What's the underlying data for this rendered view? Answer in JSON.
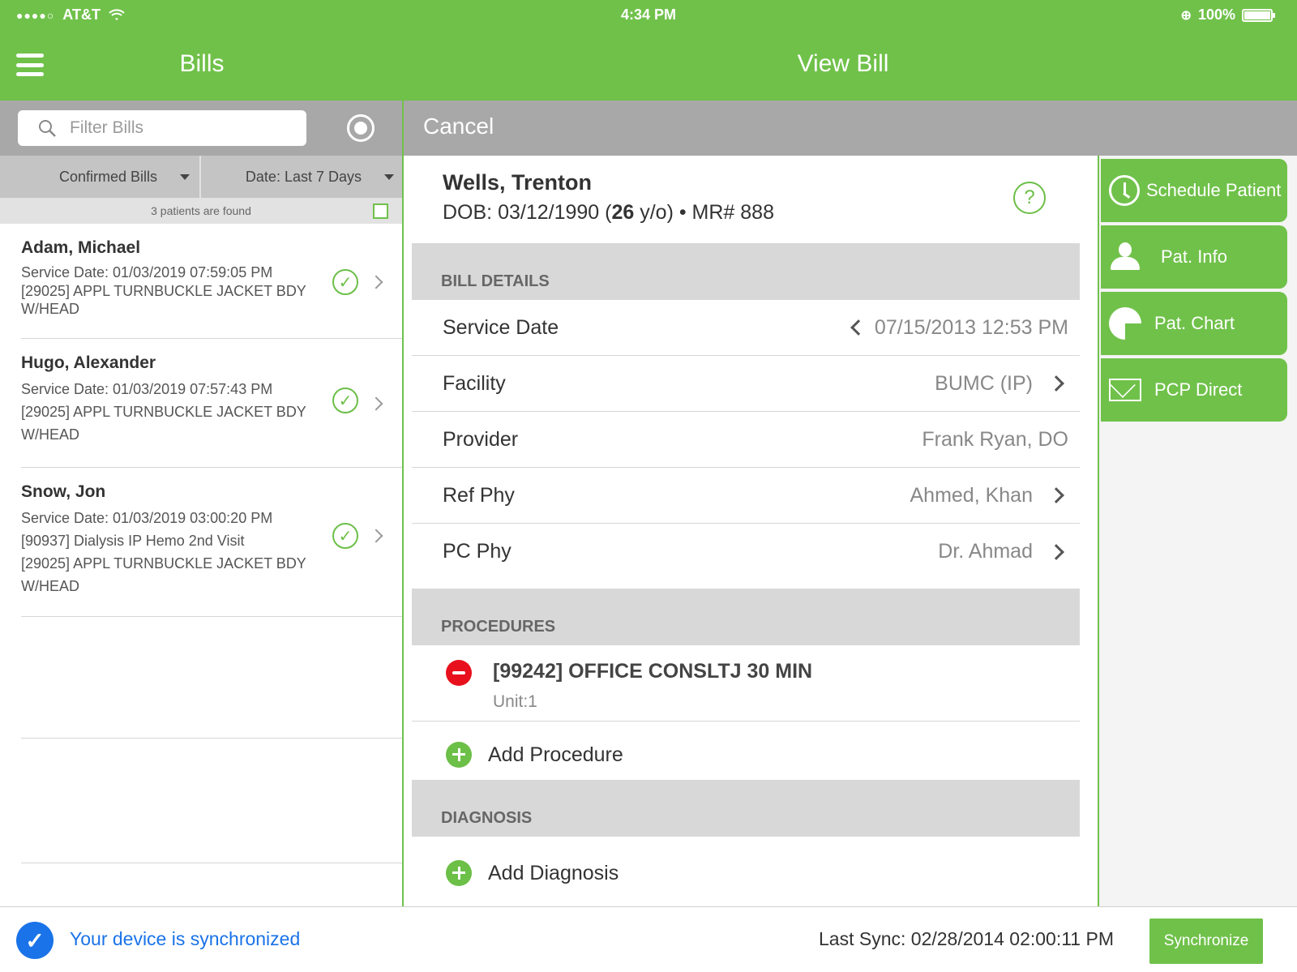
{
  "status_bar": {
    "carrier": "AT&T",
    "time": "4:34 PM",
    "battery": "100%"
  },
  "header": {
    "left_title": "Bills",
    "main_title": "View Bill"
  },
  "left_pane": {
    "search_placeholder": "Filter Bills",
    "filter_status": "Confirmed Bills",
    "filter_date": "Date: Last 7 Days",
    "count_text": "3 patients are found",
    "patients": [
      {
        "name": "Adam, Michael",
        "lines": [
          "Service Date: 01/03/2019 07:59:05 PM",
          "[29025] APPL TURNBUCKLE JACKET BDY W/HEAD"
        ]
      },
      {
        "name": "Hugo, Alexander",
        "lines": [
          "Service Date: 01/03/2019 07:57:43 PM",
          "[29025] APPL TURNBUCKLE JACKET BDY W/HEAD"
        ]
      },
      {
        "name": "Snow, Jon",
        "lines": [
          "Service Date: 01/03/2019 03:00:20 PM",
          "[90937] Dialysis IP Hemo 2nd Visit",
          "[29025] APPL TURNBUCKLE JACKET BDY W/HEAD"
        ]
      }
    ]
  },
  "main_pane": {
    "cancel_label": "Cancel",
    "patient_name": "Wells, Trenton",
    "dob_prefix": "DOB: 03/12/1990 (",
    "age": "26",
    "dob_suffix": " y/o) • MR# 888",
    "help_symbol": "?",
    "bill_details_header": "BILL DETAILS",
    "fields": {
      "service_date": {
        "label": "Service Date",
        "value": "07/15/2013 12:53 PM"
      },
      "facility": {
        "label": "Facility",
        "value": "BUMC (IP)"
      },
      "provider": {
        "label": "Provider",
        "value": "Frank Ryan, DO"
      },
      "ref_phy": {
        "label": "Ref Phy",
        "value": "Ahmed, Khan"
      },
      "pc_phy": {
        "label": "PC Phy",
        "value": "Dr. Ahmad"
      }
    },
    "procedures_header": "PROCEDURES",
    "procedure": {
      "name": "[99242] OFFICE CONSLTJ 30 MIN",
      "unit": "Unit:1"
    },
    "add_procedure": "Add Procedure",
    "diagnosis_header": "DIAGNOSIS",
    "add_diagnosis": "Add Diagnosis"
  },
  "actions": {
    "schedule_patient": "Schedule Patient",
    "pat_info": "Pat. Info",
    "pat_chart": "Pat. Chart",
    "pcp_direct": "PCP Direct"
  },
  "footer": {
    "sync_status": "Your device is synchronized",
    "last_sync": "Last Sync: 02/28/2014 02:00:11 PM",
    "sync_button": "Synchronize"
  },
  "colors": {
    "brand_green": "#70c14a",
    "header_gray": "#a8a8a8",
    "sync_blue": "#1a73e8",
    "delete_red": "#e8101d"
  }
}
